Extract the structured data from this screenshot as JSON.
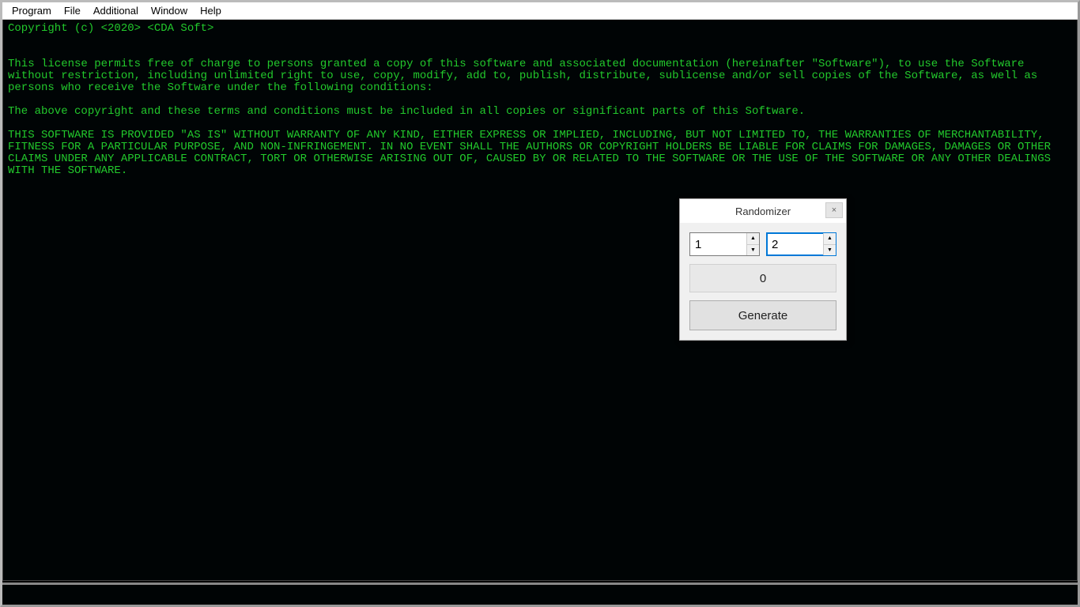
{
  "menu": {
    "items": [
      "Program",
      "File",
      "Additional",
      "Window",
      "Help"
    ]
  },
  "console": {
    "copyright": "Copyright (c) <2020> <CDA Soft>",
    "para1": "This license permits free of charge to persons granted a copy of this software and associated documentation (hereinafter \"Software\"), to use the Software without restriction, including unlimited right to use, copy, modify, add to, publish, distribute, sublicense and/or sell copies of the Software, as well as persons who receive the Software under the following conditions:",
    "para2": "The above copyright and these terms and conditions must be included in all copies or significant parts of this Software.",
    "para3": "THIS SOFTWARE IS PROVIDED \"AS IS\" WITHOUT WARRANTY OF ANY KIND, EITHER EXPRESS OR IMPLIED, INCLUDING, BUT NOT LIMITED TO, THE WARRANTIES OF MERCHANTABILITY, FITNESS FOR A PARTICULAR PURPOSE, AND NON-INFRINGEMENT. IN NO EVENT SHALL THE AUTHORS OR COPYRIGHT HOLDERS BE LIABLE FOR CLAIMS FOR DAMAGES, DAMAGES OR OTHER CLAIMS UNDER ANY APPLICABLE CONTRACT, TORT OR OTHERWISE ARISING OUT OF, CAUSED BY OR RELATED TO THE SOFTWARE OR THE USE OF THE SOFTWARE OR ANY OTHER DEALINGS WITH THE SOFTWARE."
  },
  "dialog": {
    "title": "Randomizer",
    "close_glyph": "×",
    "min_value": "1",
    "max_value": "2",
    "result": "0",
    "generate_label": "Generate",
    "spin_up": "▲",
    "spin_down": "▼"
  }
}
